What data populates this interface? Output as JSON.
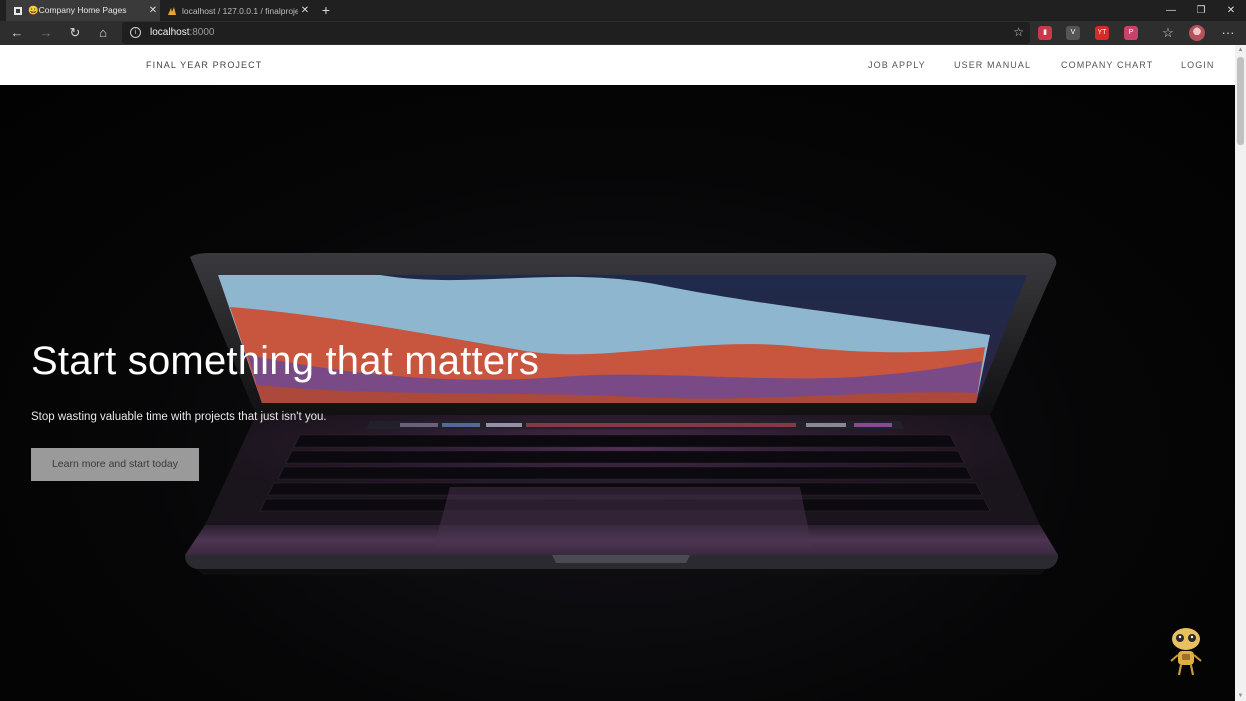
{
  "browser": {
    "tabs": [
      {
        "title": "😀Company Home Pages",
        "close": "✕"
      },
      {
        "title": "localhost / 127.0.0.1 / finalproje",
        "close": "✕"
      }
    ],
    "new_tab": "+",
    "window_controls": {
      "minimize": "—",
      "restore": "❐",
      "close": "✕"
    },
    "nav": {
      "back": "←",
      "forward": "→",
      "reload": "↻",
      "home": "⌂"
    },
    "address": {
      "host": "localhost",
      "port": ":8000",
      "info_icon": "i",
      "star": "☆"
    },
    "extensions": [
      {
        "name": "ext-flag-icon",
        "glyph": "▮",
        "color": "#c83a4a"
      },
      {
        "name": "ext-vivaldi-icon",
        "glyph": "V",
        "color": "#555555"
      },
      {
        "name": "ext-youtube-icon",
        "glyph": "YT",
        "color": "#d42a2a"
      },
      {
        "name": "ext-pocket-icon",
        "glyph": "P",
        "color": "#c8436a"
      }
    ],
    "favorites_icon": "☆",
    "menu_icon": "···"
  },
  "site": {
    "brand": "FINAL YEAR PROJECT",
    "nav_links": [
      "JOB APPLY",
      "USER MANUAL",
      "COMPANY CHART",
      "LOGIN"
    ]
  },
  "hero": {
    "headline": "Start something that matters",
    "subline": "Stop wasting valuable time with projects that just isn't you.",
    "cta": "Learn more and start today"
  },
  "colors": {
    "hero_bg": "#050506",
    "cta_bg": "#9a9a9a",
    "nav_bg": "#ffffff",
    "screen_blue": "#8fb6cf",
    "screen_orange": "#c8553e",
    "screen_purple": "#7a4a86"
  }
}
